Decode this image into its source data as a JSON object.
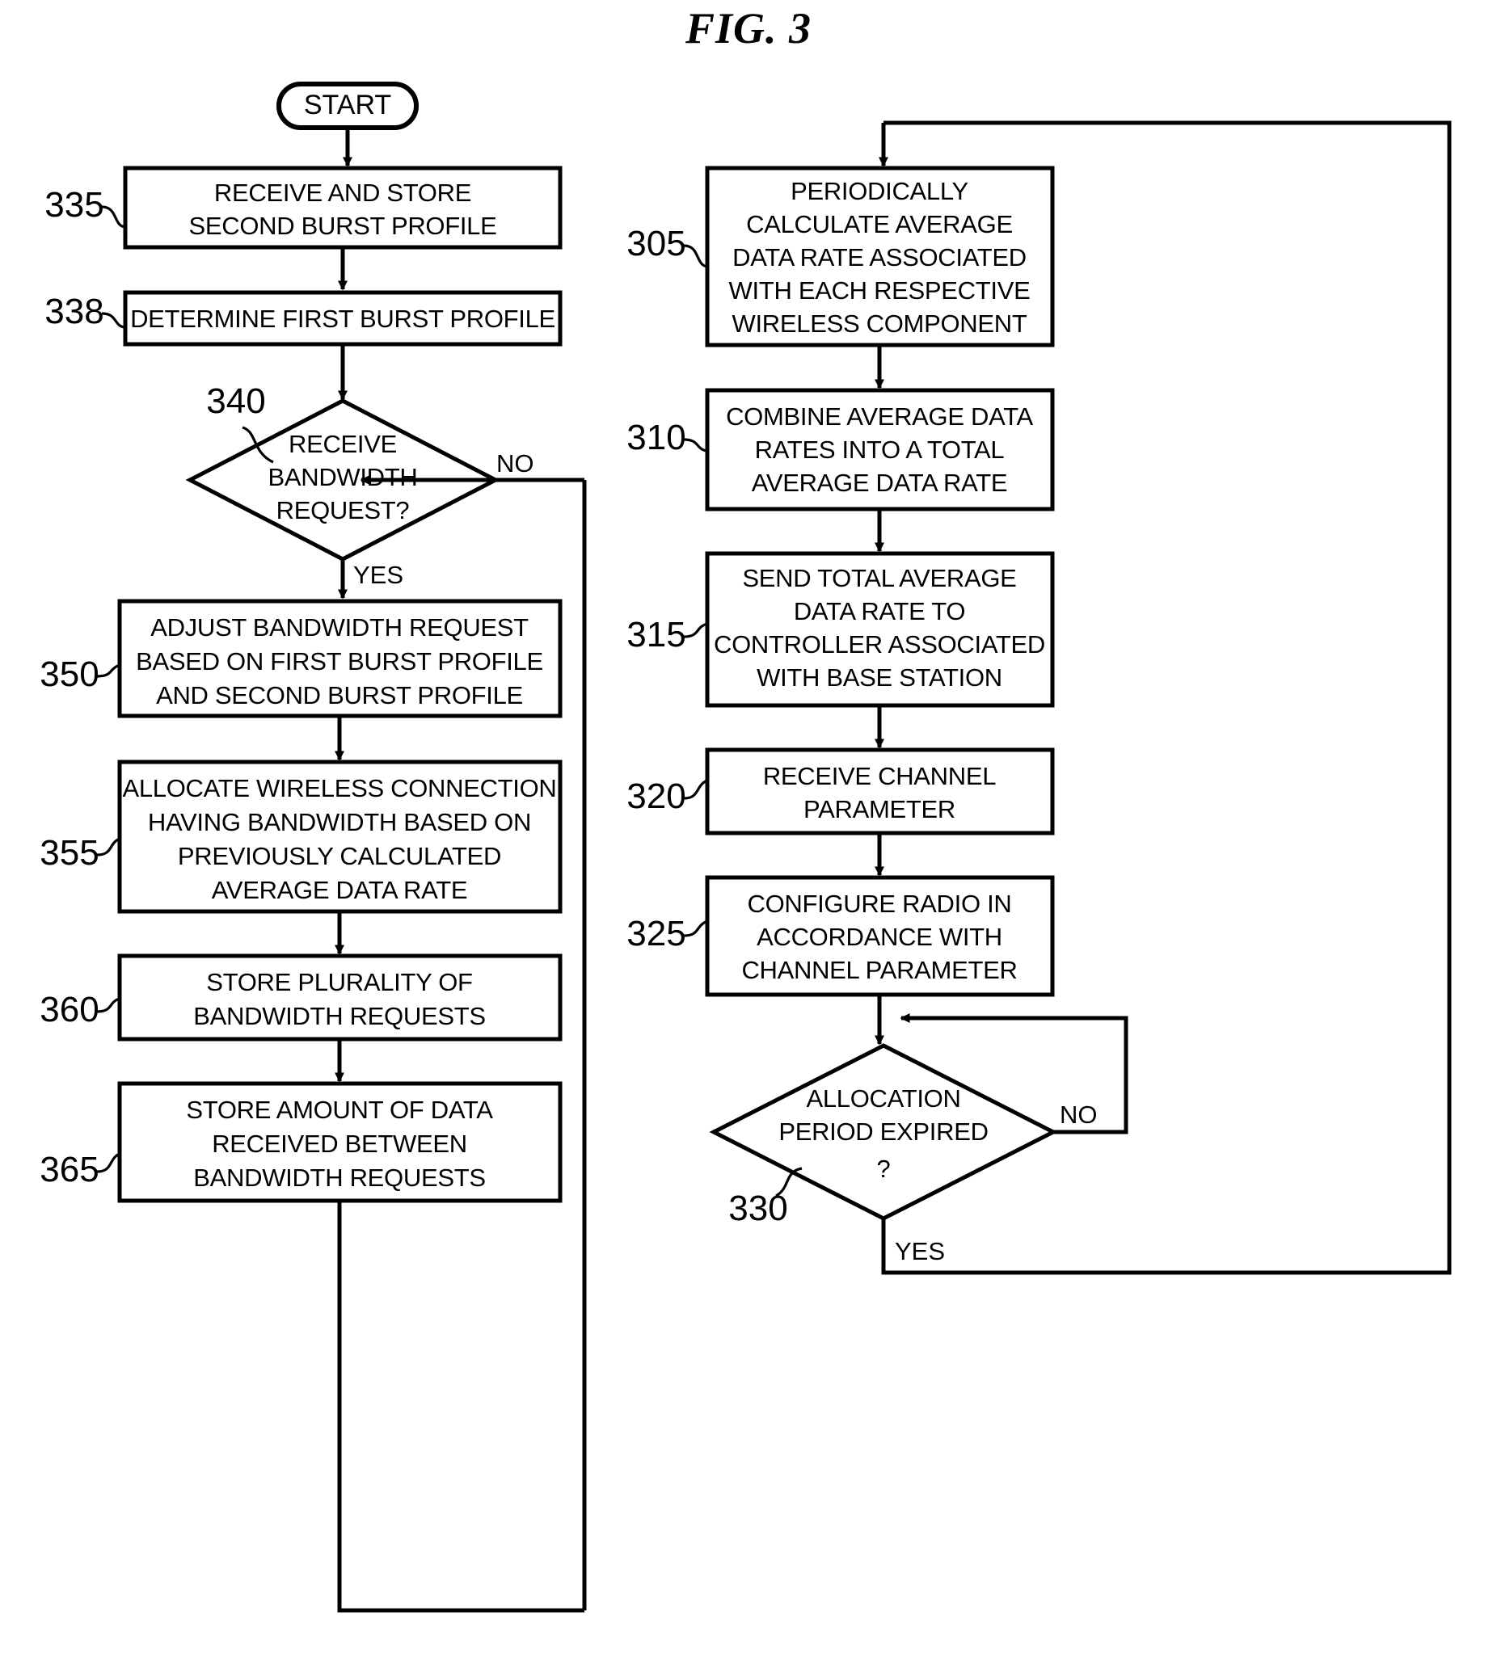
{
  "figure": {
    "title": "FIG. 3",
    "type": "flowchart"
  },
  "terminals": {
    "start": "START"
  },
  "left_column": {
    "nodes": [
      {
        "ref": "335",
        "shape": "process",
        "lines": [
          "RECEIVE AND STORE",
          "SECOND BURST PROFILE"
        ]
      },
      {
        "ref": "338",
        "shape": "process",
        "lines": [
          "DETERMINE FIRST BURST PROFILE"
        ]
      },
      {
        "ref": "340",
        "shape": "decision",
        "lines": [
          "RECEIVE",
          "BANDWIDTH",
          "REQUEST?"
        ],
        "yes_label": "YES",
        "no_label": "NO"
      },
      {
        "ref": "350",
        "shape": "process",
        "lines": [
          "ADJUST BANDWIDTH REQUEST",
          "BASED ON FIRST BURST PROFILE",
          "AND SECOND BURST PROFILE"
        ]
      },
      {
        "ref": "355",
        "shape": "process",
        "lines": [
          "ALLOCATE WIRELESS CONNECTION",
          "HAVING BANDWIDTH BASED ON",
          "PREVIOUSLY CALCULATED",
          "AVERAGE DATA RATE"
        ]
      },
      {
        "ref": "360",
        "shape": "process",
        "lines": [
          "STORE PLURALITY OF",
          "BANDWIDTH REQUESTS"
        ]
      },
      {
        "ref": "365",
        "shape": "process",
        "lines": [
          "STORE AMOUNT OF DATA",
          "RECEIVED BETWEEN",
          "BANDWIDTH REQUESTS"
        ]
      }
    ]
  },
  "right_column": {
    "nodes": [
      {
        "ref": "305",
        "shape": "process",
        "lines": [
          "PERIODICALLY",
          "CALCULATE AVERAGE",
          "DATA RATE ASSOCIATED",
          "WITH EACH RESPECTIVE",
          "WIRELESS COMPONENT"
        ]
      },
      {
        "ref": "310",
        "shape": "process",
        "lines": [
          "COMBINE AVERAGE DATA",
          "RATES INTO A TOTAL",
          "AVERAGE DATA RATE"
        ]
      },
      {
        "ref": "315",
        "shape": "process",
        "lines": [
          "SEND TOTAL AVERAGE",
          "DATA RATE TO",
          "CONTROLLER ASSOCIATED",
          "WITH BASE STATION"
        ]
      },
      {
        "ref": "320",
        "shape": "process",
        "lines": [
          "RECEIVE CHANNEL",
          "PARAMETER"
        ]
      },
      {
        "ref": "325",
        "shape": "process",
        "lines": [
          "CONFIGURE RADIO IN",
          "ACCORDANCE WITH",
          "CHANNEL PARAMETER"
        ]
      },
      {
        "ref": "330",
        "shape": "decision",
        "lines": [
          "ALLOCATION",
          "PERIOD EXPIRED",
          "?"
        ],
        "yes_label": "YES",
        "no_label": "NO"
      }
    ]
  },
  "colors": {
    "ink": "#000000",
    "paper": "#ffffff"
  }
}
